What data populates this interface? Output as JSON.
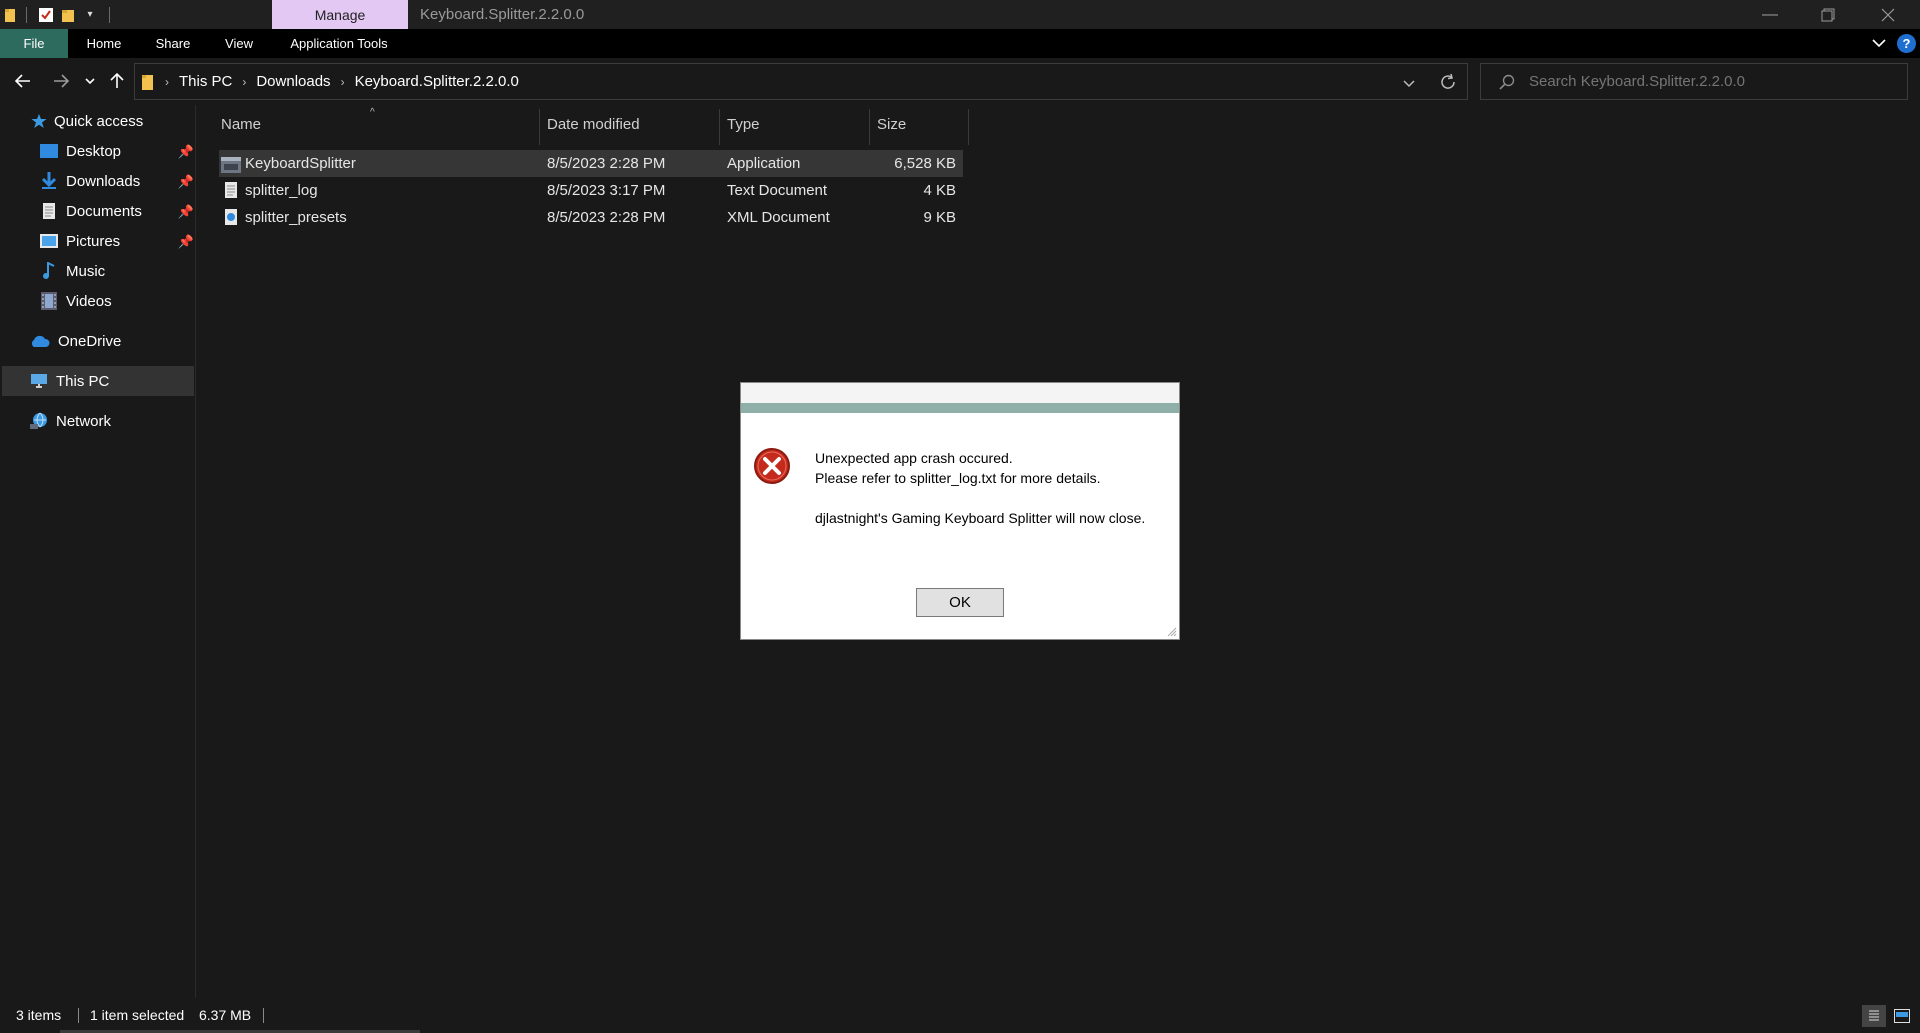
{
  "titlebar": {
    "manage_tab": "Manage",
    "window_title": "Keyboard.Splitter.2.2.0.0"
  },
  "ribbon": {
    "tabs": [
      "File",
      "Home",
      "Share",
      "View",
      "Application Tools"
    ]
  },
  "address": {
    "breadcrumbs": [
      "This PC",
      "Downloads",
      "Keyboard.Splitter.2.2.0.0"
    ]
  },
  "search": {
    "placeholder": "Search Keyboard.Splitter.2.2.0.0"
  },
  "sidebar": {
    "quick_access": "Quick access",
    "items": [
      {
        "label": "Desktop",
        "icon": "desktop-icon",
        "pinned": true
      },
      {
        "label": "Downloads",
        "icon": "download-icon",
        "pinned": true
      },
      {
        "label": "Documents",
        "icon": "document-icon",
        "pinned": true
      },
      {
        "label": "Pictures",
        "icon": "pictures-icon",
        "pinned": true
      },
      {
        "label": "Music",
        "icon": "music-icon",
        "pinned": false
      },
      {
        "label": "Videos",
        "icon": "videos-icon",
        "pinned": false
      }
    ],
    "onedrive": "OneDrive",
    "this_pc": "This PC",
    "network": "Network"
  },
  "columns": {
    "name": "Name",
    "date": "Date modified",
    "type": "Type",
    "size": "Size"
  },
  "files": [
    {
      "name": "KeyboardSplitter",
      "date": "8/5/2023 2:28 PM",
      "type": "Application",
      "size": "6,528 KB",
      "selected": true
    },
    {
      "name": "splitter_log",
      "date": "8/5/2023 3:17 PM",
      "type": "Text Document",
      "size": "4 KB",
      "selected": false
    },
    {
      "name": "splitter_presets",
      "date": "8/5/2023 2:28 PM",
      "type": "XML Document",
      "size": "9 KB",
      "selected": false
    }
  ],
  "statusbar": {
    "items_count": "3 items",
    "selected": "1 item selected",
    "selected_size": "6.37 MB"
  },
  "dialog": {
    "line1": "Unexpected app crash occured.",
    "line2": "Please refer to splitter_log.txt for more details.",
    "line3": "djlastnight's Gaming Keyboard Splitter will now close.",
    "ok_label": "OK"
  },
  "colors": {
    "manage_tab": "#e3c8f4",
    "file_tab": "#2d6b5e",
    "error_red": "#c42b1c",
    "folder_yellow": "#f2c14e",
    "accent_blue": "#3b9ae1"
  }
}
